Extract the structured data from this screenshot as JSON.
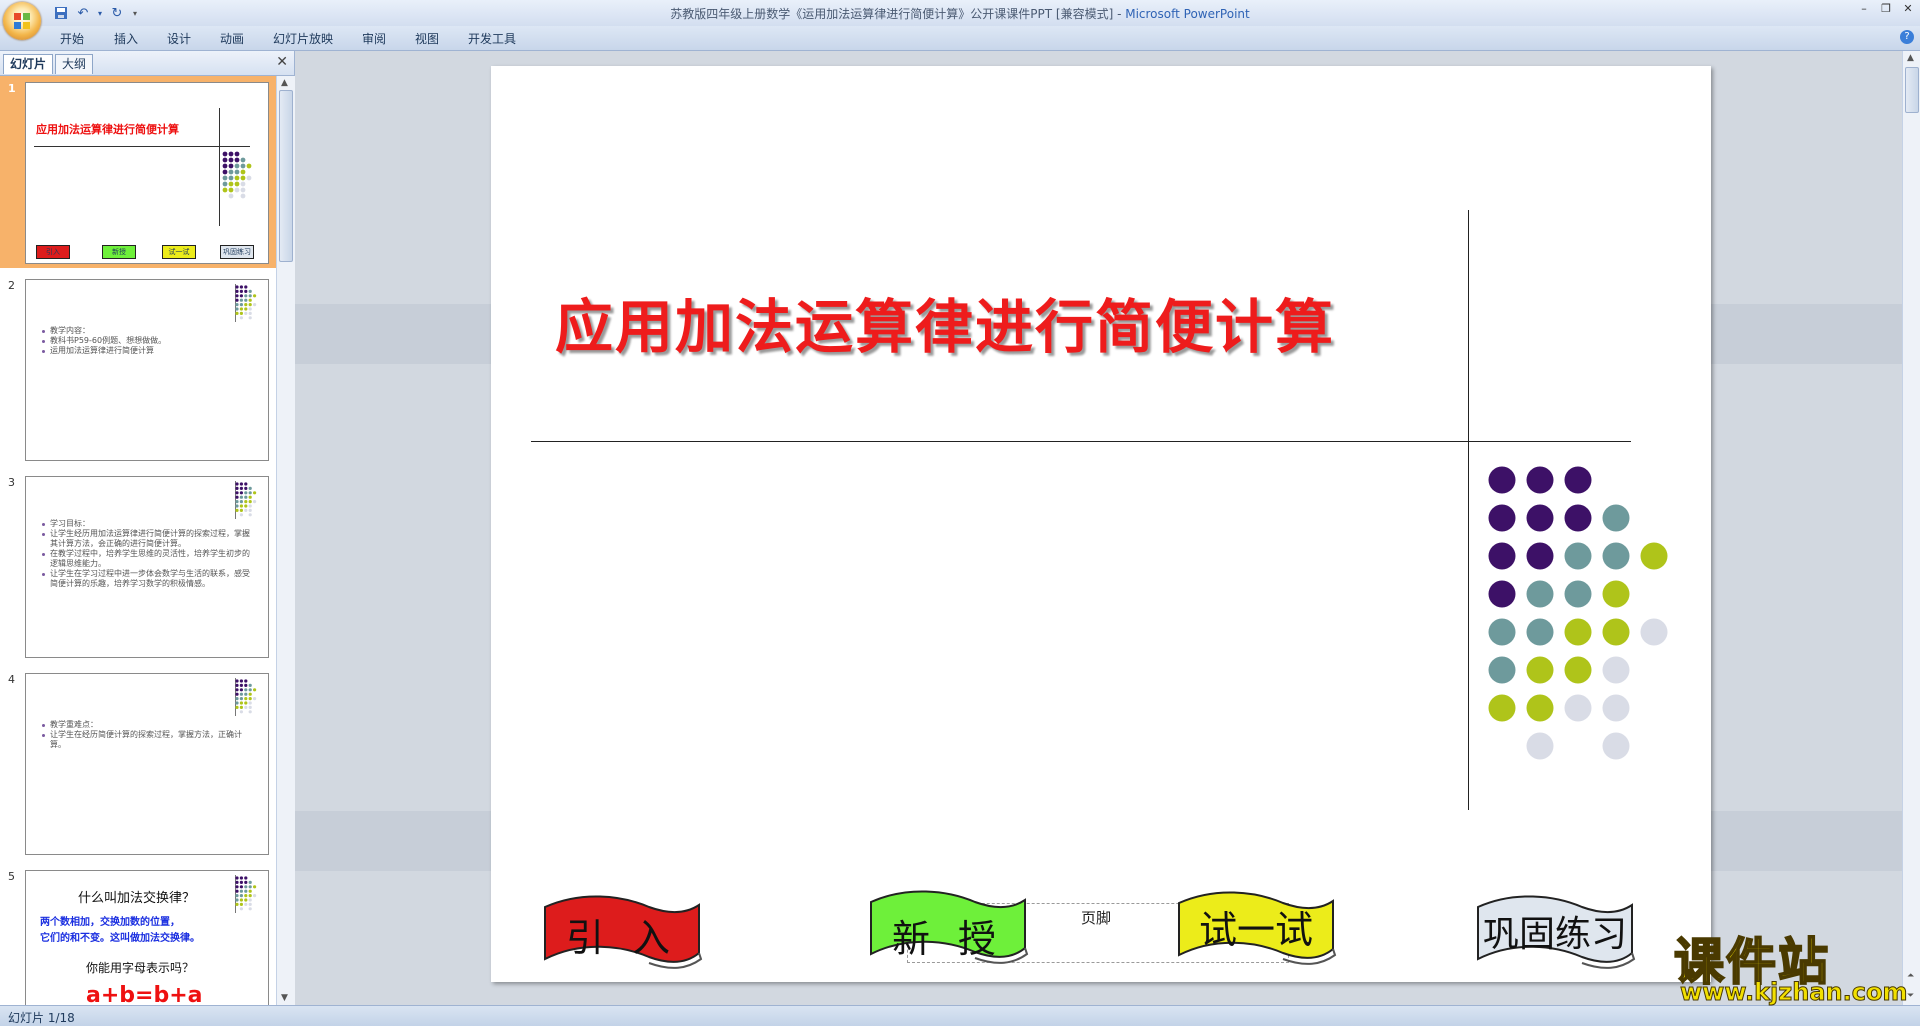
{
  "window": {
    "title_doc": "苏教版四年级上册数学《运用加法运算律进行简便计算》公开课课件PPT [兼容模式]",
    "title_sep": " - ",
    "title_app": "Microsoft PowerPoint",
    "help": "?"
  },
  "ribbon_tabs": [
    "开始",
    "插入",
    "设计",
    "动画",
    "幻灯片放映",
    "审阅",
    "视图",
    "开发工具"
  ],
  "pane": {
    "tab_slides": "幻灯片",
    "tab_outline": "大纲",
    "close": "✕"
  },
  "thumbnails": [
    {
      "num": "1",
      "title": "应用加法运算律进行简便计算",
      "buttons": [
        "引入",
        "新授",
        "试一试",
        "巩固练习"
      ]
    },
    {
      "num": "2",
      "bullets": [
        "教学内容：",
        "教科书P59-60例题、想想做做。",
        "运用加法运算律进行简便计算"
      ]
    },
    {
      "num": "3",
      "bullets": [
        "学习目标：",
        "让学生经历用加法运算律进行简便计算的探索过程，掌握其计算方法，会正确的进行简便计算。",
        "在教学过程中，培养学生思维的灵活性，培养学生初步的逻辑思维能力。",
        "让学生在学习过程中进一步体会数学与生活的联系，感受简便计算的乐趣，培养学习数学的积极情感。"
      ]
    },
    {
      "num": "4",
      "bullets": [
        "教学重难点：",
        "让学生在经历简便计算的探索过程，掌握方法，正确计算。"
      ]
    },
    {
      "num": "5",
      "heading": "什么叫加法交换律？",
      "body1": "两个数相加，交换加数的位置，",
      "body2": "它们的和不变。这叫做加法交换律。",
      "question": "你能用字母表示吗？",
      "formula": "a+b=b+a"
    }
  ],
  "slide": {
    "title": "应用加法运算律进行简便计算",
    "footer": "页脚",
    "buttons": [
      {
        "label": "引 入",
        "color": "#dd1c1c"
      },
      {
        "label": "新 授",
        "color": "#6ef03a"
      },
      {
        "label": "试一试",
        "color": "#ecec1a"
      },
      {
        "label": "巩固练习",
        "color": "#dfe6ee"
      }
    ],
    "dot_colors": {
      "purple": "#3d1167",
      "teal": "#6e9a9c",
      "lime": "#afc41a",
      "gray": "#d9dce6"
    }
  },
  "status": {
    "slide_counter": "幻灯片 1/18"
  },
  "watermark": {
    "main": "课件站",
    "url": "www.kjzhan.com"
  }
}
